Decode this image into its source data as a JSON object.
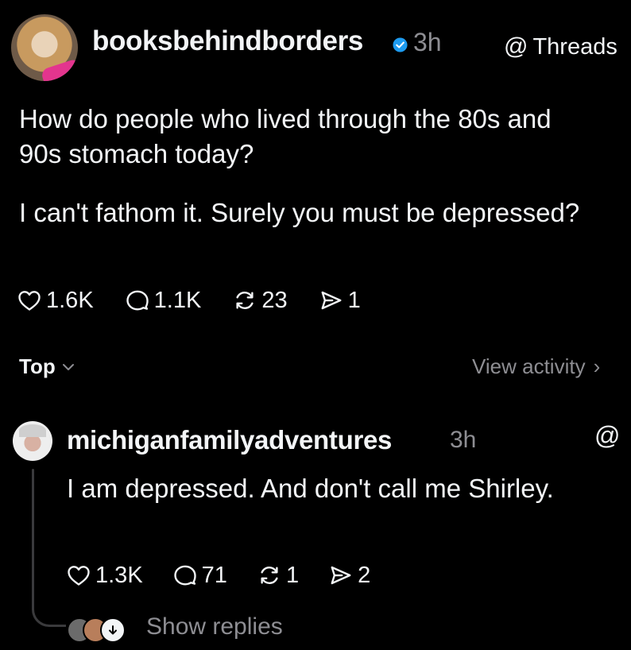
{
  "post": {
    "username": "booksbehindborders",
    "verified_color": "#1d9bf0",
    "time": "3h",
    "threads_label": "Threads",
    "paragraphs": [
      "How do people who lived through the 80s and 90s stomach today?",
      "I can't fathom it. Surely you must be depressed?"
    ],
    "stats": {
      "likes": "1.6K",
      "comments": "1.1K",
      "reposts": "23",
      "shares": "1"
    }
  },
  "sort_bar": {
    "sort_label": "Top",
    "view_activity_label": "View activity",
    "chevron_right": "›"
  },
  "reply": {
    "username": "michiganfamilyadventures",
    "time": "3h",
    "text": "I am depressed. And don't call me Shirley.",
    "stats": {
      "likes": "1.3K",
      "comments": "71",
      "reposts": "1",
      "shares": "2"
    },
    "show_replies_label": "Show replies"
  },
  "icons": {
    "threads_glyph": "@",
    "heart": "heart-icon",
    "comment": "comment-icon",
    "repost": "repost-icon",
    "share": "share-icon"
  },
  "colors": {
    "background": "#000000",
    "text_primary": "#f3f5f7",
    "text_secondary": "#8e8e93"
  }
}
